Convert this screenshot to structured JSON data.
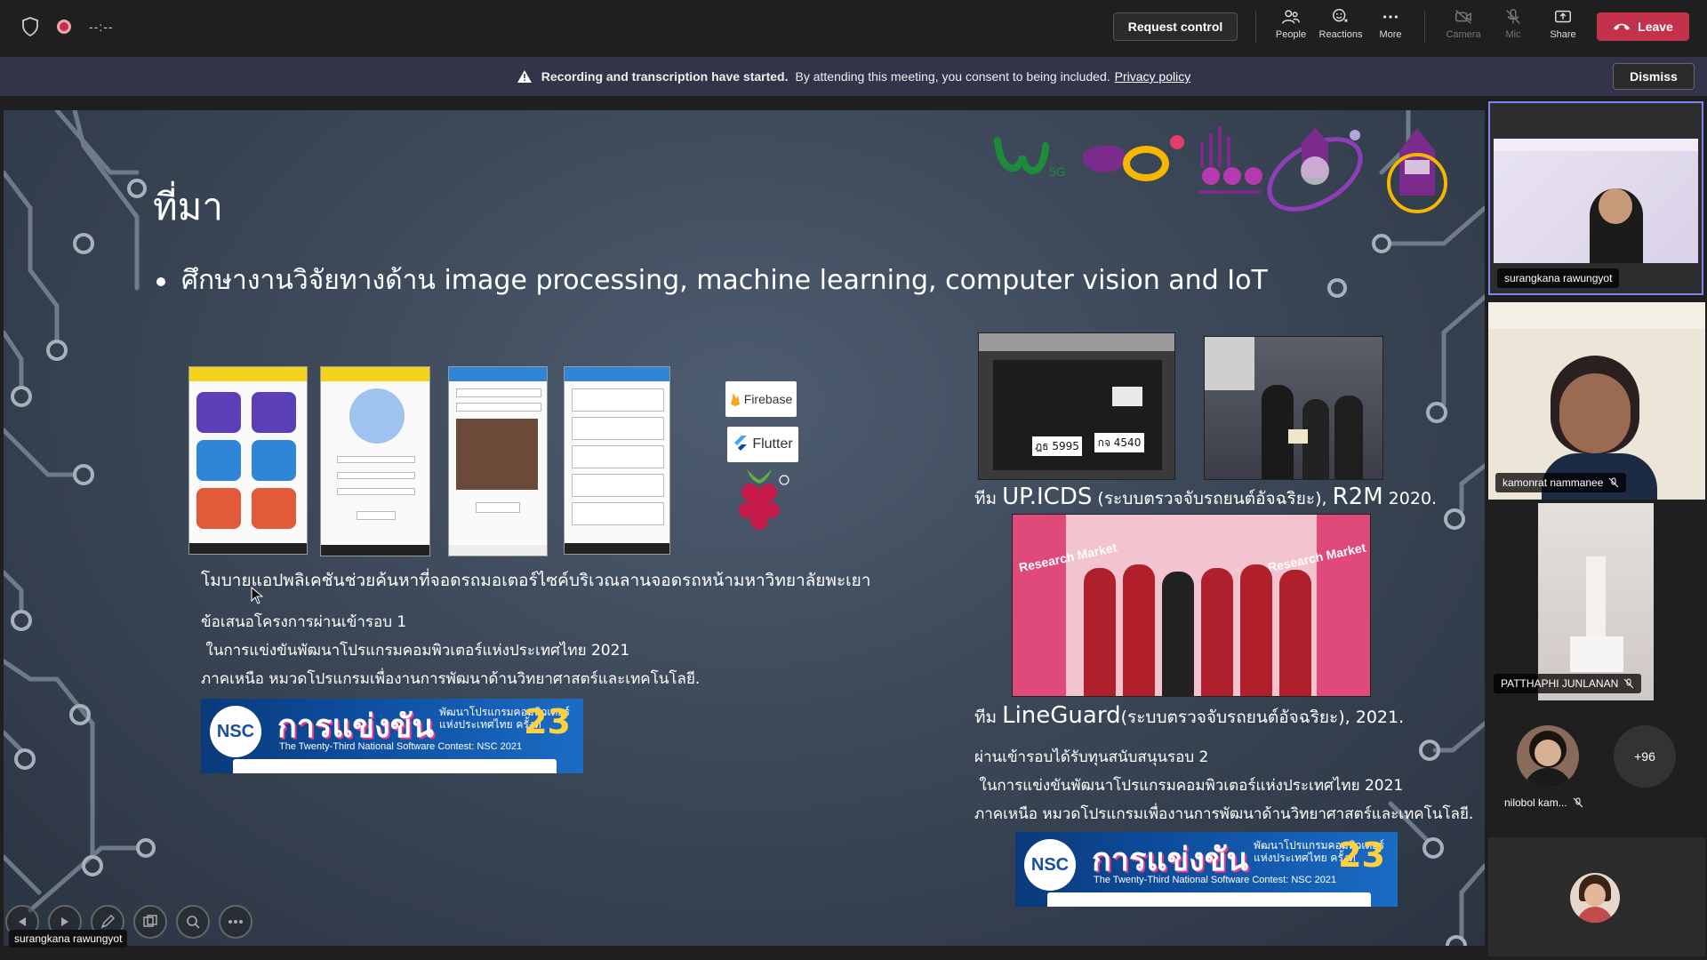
{
  "topbar": {
    "timer": "--:--",
    "request_control": "Request control",
    "tools": [
      {
        "label": "People",
        "icon": "people-icon"
      },
      {
        "label": "Reactions",
        "icon": "reactions-icon"
      },
      {
        "label": "More",
        "icon": "more-icon"
      },
      {
        "label": "Camera",
        "icon": "camera-off-icon"
      },
      {
        "label": "Mic",
        "icon": "mic-off-icon"
      },
      {
        "label": "Share",
        "icon": "share-icon"
      }
    ],
    "leave": "Leave"
  },
  "banner": {
    "bold": "Recording and transcription have started.",
    "text": "By attending this meeting, you consent to being included.",
    "link": "Privacy policy",
    "dismiss": "Dismiss"
  },
  "slide": {
    "title": "ที่มา",
    "bullet": "ศึกษางานวิจัยทางด้าน image processing, machine learning, computer vision and IoT",
    "tech": [
      "Firebase",
      "Flutter"
    ],
    "app_caption": "โมบายแอปพลิเคชันช่วยค้นหาที่จอดรถมอเตอร์ไซค์บริเวณลานจอดรถหน้ามหาวิทยาลัยพะเยา",
    "left_lines": [
      "ข้อเสนอโครงการผ่านเข้ารอบ 1",
      " ในการแข่งขันพัฒนาโปรแกรมคอมพิวเตอร์แห่งประเทศไทย 2021",
      "ภาคเหนือ หมวดโปรแกรมเพื่องานการพัฒนาด้านวิทยาศาสตร์และเทคโนโลยี."
    ],
    "team1": {
      "prefix": "ทีม ",
      "name": "UP.ICDS",
      "desc": " (ระบบตรวจจับรถยนต์อัจฉริยะ), ",
      "event": "R2M",
      "year": " 2020."
    },
    "team2": {
      "prefix": "ทีม ",
      "name": "LineGuard",
      "desc": "(ระบบตรวจจับรถยนต์อัจฉริยะ), 2021."
    },
    "right_lines": [
      "ผ่านเข้ารอบได้รับทุนสนับสนุนรอบ 2",
      " ในการแข่งขันพัฒนาโปรแกรมคอมพิวเตอร์แห่งประเทศไทย 2021",
      "ภาคเหนือ หมวดโปรแกรมเพื่องานการพัฒนาด้านวิทยาศาสตร์และเทคโนโลยี."
    ],
    "nsc": {
      "logo": "NSC",
      "big": "การแข่งขัน",
      "small1": "พัฒนาโปรแกรมคอมพิวเตอร์",
      "small2": "แห่งประเทศไทย ครั้งที่",
      "num": "23",
      "en": "The Twenty-Third National Software Contest: NSC 2021"
    },
    "photo1_plates": [
      "ฎธ 5995",
      "กจ 4540"
    ],
    "photo3_sign": "Research Market"
  },
  "presenter": "surangkana rawungyot",
  "participants": [
    {
      "name": "surangkana rawungyot"
    },
    {
      "name": "kamonrat nammanee"
    },
    {
      "name": "PATTHAPHI JUNLANAN"
    },
    {
      "name": "nilobol kam..."
    }
  ],
  "more_count": "+96",
  "colors": {
    "leave": "#c4314b",
    "banner": "#33344a",
    "active_tile": "#7f85f5"
  }
}
